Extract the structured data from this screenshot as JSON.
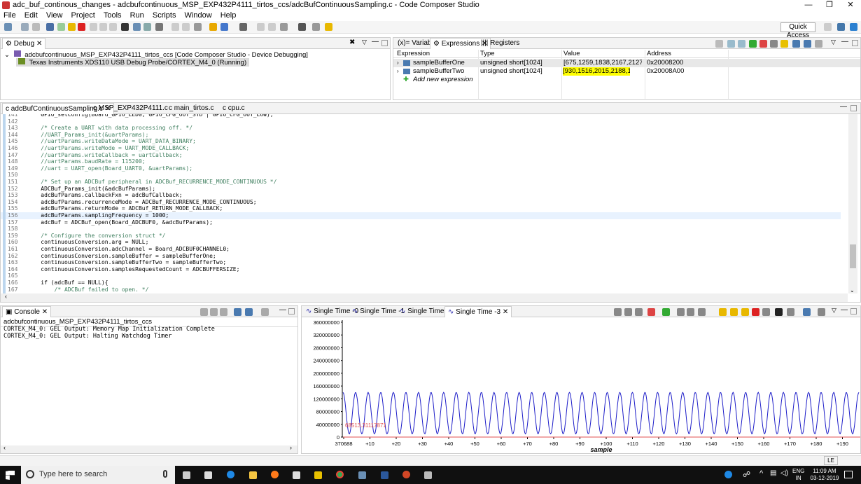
{
  "window": {
    "title": "adc_buf_continous_changes - adcbufcontinuous_MSP_EXP432P4111_tirtos_ccs/adcBufContinuousSampling.c - Code Composer Studio",
    "min": "—",
    "max": "❐",
    "close": "✕"
  },
  "menu": [
    "File",
    "Edit",
    "View",
    "Project",
    "Tools",
    "Run",
    "Scripts",
    "Window",
    "Help"
  ],
  "toolbar": {
    "quick_access": "Quick Access"
  },
  "debug": {
    "tab": "Debug",
    "project": "adcbufcontinuous_MSP_EXP432P4111_tirtos_ccs [Code Composer Studio - Device Debugging]",
    "probe": "Texas Instruments XDS110 USB Debug Probe/CORTEX_M4_0 (Running)"
  },
  "vars": {
    "tabs": [
      "Variables",
      "Expressions",
      "Registers"
    ],
    "columns": [
      "Expression",
      "Type",
      "Value",
      "Address"
    ],
    "rows": [
      {
        "expr": "sampleBufferOne",
        "type": "unsigned short[1024]",
        "value": "[675,1259,1838,2167,2127...]",
        "addr": "0x20008200"
      },
      {
        "expr": "sampleBufferTwo",
        "type": "unsigned short[1024]",
        "value": "[930,1516,2015,2188,1997...]",
        "addr": "0x20008A00"
      }
    ],
    "add": "Add new expression",
    "highlight_color": "#ffff00"
  },
  "editor": {
    "tabs": [
      "adcBufContinuousSampling.c",
      "MSP_EXP432P4111.c",
      "main_tirtos.c",
      "cpu.c"
    ],
    "lines": [
      [
        "141",
        "    GPIO_setConfig(Board_GPIO_LED0, GPIO_CFG_OUT_STD | GPIO_CFG_OUT_LOW);"
      ],
      [
        "142",
        ""
      ],
      [
        "143",
        "    /* Create a UART with data processing off. */"
      ],
      [
        "144",
        "    //UART_Params_init(&uartParams);"
      ],
      [
        "145",
        "    //uartParams.writeDataMode = UART_DATA_BINARY;"
      ],
      [
        "146",
        "    //uartParams.writeMode = UART_MODE_CALLBACK;"
      ],
      [
        "147",
        "    //uartParams.writeCallback = uartCallback;"
      ],
      [
        "148",
        "    //uartParams.baudRate = 115200;"
      ],
      [
        "149",
        "    //uart = UART_open(Board_UART0, &uartParams);"
      ],
      [
        "150",
        ""
      ],
      [
        "151",
        "    /* Set up an ADCBuf peripheral in ADCBuf_RECURRENCE_MODE_CONTINUOUS */"
      ],
      [
        "152",
        "    ADCBuf_Params_init(&adcBufParams);"
      ],
      [
        "153",
        "    adcBufParams.callbackFxn = adcBufCallback;"
      ],
      [
        "154",
        "    adcBufParams.recurrenceMode = ADCBuf_RECURRENCE_MODE_CONTINUOUS;"
      ],
      [
        "155",
        "    adcBufParams.returnMode = ADCBuf_RETURN_MODE_CALLBACK;"
      ],
      [
        "156",
        "    adcBufParams.samplingFrequency = 1000;"
      ],
      [
        "157",
        "    adcBuf = ADCBuf_open(Board_ADCBUF0, &adcBufParams);"
      ],
      [
        "158",
        ""
      ],
      [
        "159",
        "    /* Configure the conversion struct */"
      ],
      [
        "160",
        "    continuousConversion.arg = NULL;"
      ],
      [
        "161",
        "    continuousConversion.adcChannel = Board_ADCBUF0CHANNEL0;"
      ],
      [
        "162",
        "    continuousConversion.sampleBuffer = sampleBufferOne;"
      ],
      [
        "163",
        "    continuousConversion.sampleBufferTwo = sampleBufferTwo;"
      ],
      [
        "164",
        "    continuousConversion.samplesRequestedCount = ADCBUFFERSIZE;"
      ],
      [
        "165",
        ""
      ],
      [
        "166",
        "    if (adcBuf == NULL){"
      ],
      [
        "167",
        "        /* ADCBuf failed to open. */"
      ],
      [
        "168",
        "        while(1);"
      ]
    ]
  },
  "console": {
    "tab": "Console",
    "header": "adcbufcontinuous_MSP_EXP432P4111_tirtos_ccs",
    "lines": [
      "CORTEX_M4_0: GEL Output: Memory Map Initialization Complete",
      "CORTEX_M4_0: GEL Output: Halting Watchdog Timer"
    ]
  },
  "graph": {
    "tabs": [
      "Single Time -0",
      "Single Time -1",
      "Single Time -2",
      "Single Time -3"
    ],
    "marker_value": "68513.31117871",
    "status": "LE"
  },
  "chart_data": {
    "type": "line",
    "yticks": [
      "360000000",
      "320000000",
      "280000000",
      "240000000",
      "200000000",
      "160000000",
      "120000000",
      "80000000",
      "40000000",
      "0"
    ],
    "ylim": [
      0,
      360000000
    ],
    "xticks": [
      "370688",
      "+10",
      "+20",
      "+30",
      "+40",
      "+50",
      "+60",
      "+70",
      "+80",
      "+90",
      "+100",
      "+110",
      "+120",
      "+130",
      "+140",
      "+150",
      "+160",
      "+170",
      "+180",
      "+190"
    ],
    "xlabel": "sample",
    "series": [
      {
        "color": "#1c1cc8",
        "cycles": 41,
        "min": 10000000,
        "max": 140000000
      },
      {
        "color": "#e05050",
        "value": 0
      }
    ]
  },
  "taskbar": {
    "search": "Type here to search",
    "lang1": "ENG",
    "lang2": "IN",
    "time": "11:09 AM",
    "date": "03-12-2019"
  }
}
